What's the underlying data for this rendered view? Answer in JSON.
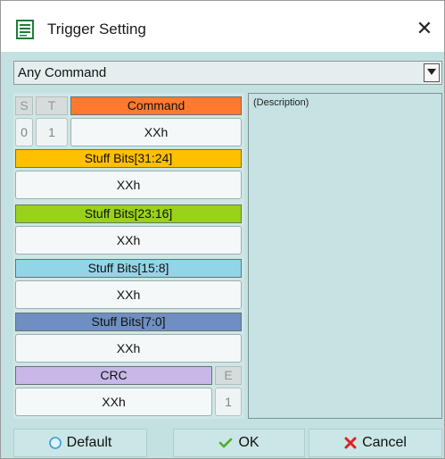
{
  "window": {
    "title": "Trigger Setting"
  },
  "dropdown": {
    "value": "Any Command"
  },
  "frame": {
    "s_label": "S",
    "t_label": "T",
    "command_label": "Command",
    "s_value": "0",
    "t_value": "1",
    "command_value": "XXh",
    "fields": [
      {
        "label": "Stuff Bits[31:24]",
        "value": "XXh",
        "color": "#ffc000"
      },
      {
        "label": "Stuff Bits[23:16]",
        "value": "XXh",
        "color": "#99d21a"
      },
      {
        "label": "Stuff Bits[15:8]",
        "value": "XXh",
        "color": "#93d5e8"
      },
      {
        "label": "Stuff Bits[7:0]",
        "value": "XXh",
        "color": "#6f8fc2"
      }
    ],
    "crc_label": "CRC",
    "crc_value": "XXh",
    "e_label": "E",
    "e_value": "1",
    "command_color": "#ff7a2e",
    "crc_color": "#c8b8e8"
  },
  "description": {
    "text": "(Description)"
  },
  "buttons": {
    "default_label": "Default",
    "ok_label": "OK",
    "cancel_label": "Cancel"
  },
  "icons": {
    "window": "document-list-icon",
    "close": "close-icon",
    "default": "circle-icon",
    "ok": "checkmark-icon",
    "cancel": "cross-icon",
    "dropdown": "chevron-down-icon"
  }
}
